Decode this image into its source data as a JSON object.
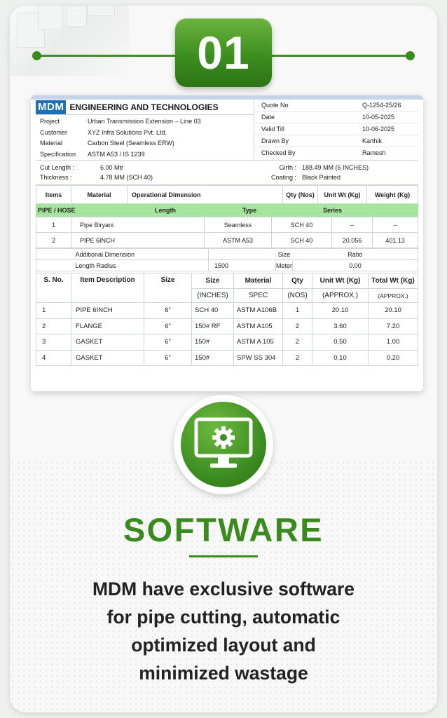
{
  "badge_number": "01",
  "document": {
    "logo": "MDM",
    "company": "ENGINEERING AND TECHNOLOGIES",
    "left_fields": [
      {
        "key": "Project",
        "value": "Urban Transmission Extension – Line 03"
      },
      {
        "key": "Customer",
        "value": "XYZ Infra Solutions Pvt. Ltd."
      },
      {
        "key": "Material",
        "value": "Carbon Steel (Seamless ERW)"
      },
      {
        "key": "Specification",
        "value": "ASTM A53 / IS 1239"
      }
    ],
    "right_fields": [
      {
        "key": "Quote No",
        "value": "Q-1254-25/26"
      },
      {
        "key": "Date",
        "value": "10-05-2025"
      },
      {
        "key": "Valid Till",
        "value": "10-06-2025"
      },
      {
        "key": "Drawn By",
        "value": "Karthik"
      },
      {
        "key": "Checked By",
        "value": "Ramesh"
      }
    ],
    "specs": {
      "cut_length_label": "Cut Length :",
      "cut_length_value": "6.00 Mtr",
      "thickness_label": "Thickness :",
      "thickness_value": "4.78 MM (SCH 40)",
      "girth_label": "Girth :",
      "girth_value": "188.49 MM (6 INCHES)",
      "coating_label": "Coating :",
      "coating_value": "Black Painted"
    },
    "table1_headers": {
      "items": "Items",
      "material": "Material",
      "op_dim": "Operational Dimension",
      "qty": "Qty (Nos)",
      "unit_wt": "Unit Wt (Kg)",
      "weight": "Weight (Kg)"
    },
    "green_bar": {
      "pipe": "PIPE / HOSE",
      "length": "Length",
      "type": "Type",
      "series": "Series"
    },
    "table2_rows": [
      {
        "n": "1",
        "name": "Pipe Biryani",
        "type": "Seamless",
        "series": "SCH 40",
        "unit": "--",
        "weight": "--"
      },
      {
        "n": "2",
        "name": "PIPE 6INCH",
        "type": "ASTM A53",
        "series": "SCH 40",
        "unit": "20.056",
        "weight": "401.13"
      }
    ],
    "additional": {
      "label": "Additional Dimension",
      "size": "Size",
      "ratio": "Ratio",
      "radius_label": "Length Radius",
      "radius_value": "1500",
      "meter": "Meter",
      "meter_value": "0.00"
    },
    "table3_headers": {
      "sno": "S. No.",
      "desc": "Item Description",
      "size": "Size",
      "size2": "Size",
      "inches": "(INCHES)",
      "material": "Material",
      "spec": "SPEC",
      "qty": "Qty",
      "nos": "(NOS)",
      "unit": "Unit Wt (Kg)",
      "approx": "(APPROX.)",
      "total": "Total Wt (Kg)",
      "approx2": "(APPROX.)"
    },
    "table3_rows": [
      {
        "n": "1",
        "desc": "PIPE 6INCH",
        "size": "6\"",
        "inches": "SCH 40",
        "spec": "ASTM A106B",
        "qty": "1",
        "unit": "20.10",
        "total": "20.10"
      },
      {
        "n": "2",
        "desc": "FLANGE",
        "size": "6\"",
        "inches": "150# RF",
        "spec": "ASTM A105",
        "qty": "2",
        "unit": "3.60",
        "total": "7.20"
      },
      {
        "n": "3",
        "desc": "GASKET",
        "size": "6\"",
        "inches": "150#",
        "spec": "ASTM A 105",
        "qty": "2",
        "unit": "0.50",
        "total": "1.00"
      },
      {
        "n": "4",
        "desc": "GASKET",
        "size": "6\"",
        "inches": "150#",
        "spec": "SPW SS 304",
        "qty": "2",
        "unit": "0.10",
        "total": "0.20"
      }
    ]
  },
  "icon": "monitor-gear-icon",
  "title": "SOFTWARE",
  "description_lines": [
    "MDM have exclusive software",
    "for pipe cutting, automatic",
    "optimized layout and",
    "minimized wastage"
  ],
  "colors": {
    "brand_green": "#3b8a1e",
    "table_green": "#a6e59e",
    "logo_blue": "#1f6fb8"
  }
}
